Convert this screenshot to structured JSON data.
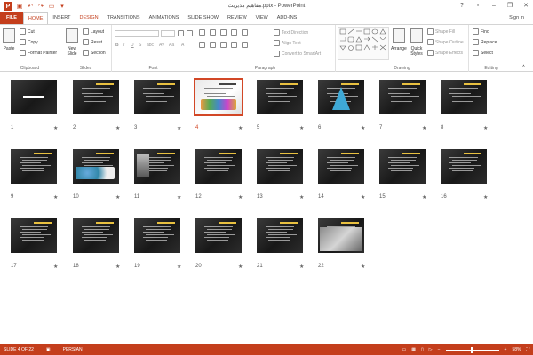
{
  "window": {
    "title": "مفاهيم مديريت.pptx - PowerPoint",
    "app_letter": "P",
    "sign_in": "Sign in"
  },
  "tabs": [
    "FILE",
    "HOME",
    "INSERT",
    "DESIGN",
    "TRANSITIONS",
    "ANIMATIONS",
    "SLIDE SHOW",
    "REVIEW",
    "VIEW",
    "ADD-INS"
  ],
  "ribbon": {
    "clipboard": {
      "label": "Clipboard",
      "paste": "Paste",
      "cut": "Cut",
      "copy": "Copy",
      "format_painter": "Format Painter"
    },
    "slides": {
      "label": "Slides",
      "new_slide": "New Slide",
      "layout": "Layout",
      "reset": "Reset",
      "section": "Section"
    },
    "font": {
      "label": "Font"
    },
    "paragraph": {
      "label": "Paragraph",
      "text_direction": "Text Direction",
      "align_text": "Align Text",
      "convert_smartart": "Convert to SmartArt"
    },
    "drawing": {
      "label": "Drawing",
      "arrange": "Arrange",
      "quick_styles": "Quick Styles",
      "shape_fill": "Shape Fill",
      "shape_outline": "Shape Outline",
      "shape_effects": "Shape Effects"
    },
    "editing": {
      "label": "Editing",
      "find": "Find",
      "replace": "Replace",
      "select": "Select"
    }
  },
  "slides": [
    {
      "n": "1"
    },
    {
      "n": "2"
    },
    {
      "n": "3"
    },
    {
      "n": "4"
    },
    {
      "n": "5"
    },
    {
      "n": "6"
    },
    {
      "n": "7"
    },
    {
      "n": "8"
    },
    {
      "n": "9"
    },
    {
      "n": "10"
    },
    {
      "n": "11"
    },
    {
      "n": "12"
    },
    {
      "n": "13"
    },
    {
      "n": "14"
    },
    {
      "n": "15"
    },
    {
      "n": "16"
    },
    {
      "n": "17"
    },
    {
      "n": "18"
    },
    {
      "n": "19"
    },
    {
      "n": "20"
    },
    {
      "n": "21"
    },
    {
      "n": "22"
    }
  ],
  "selected_slide": 4,
  "status": {
    "slide_info": "SLIDE 4 OF 22",
    "language": "PERSIAN",
    "zoom": "58%"
  },
  "colors": {
    "accent": "#c43e1c",
    "selection": "#d24726"
  }
}
